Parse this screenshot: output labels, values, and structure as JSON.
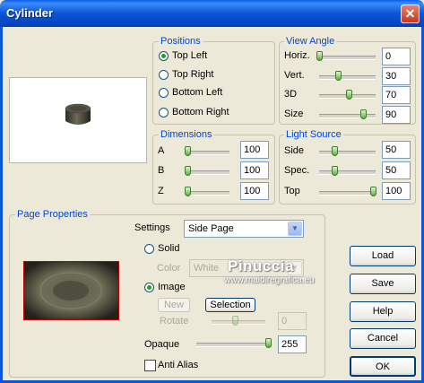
{
  "window": {
    "title": "Cylinder",
    "close_glyph": "✕"
  },
  "positions": {
    "legend": "Positions",
    "options": [
      "Top Left",
      "Top Right",
      "Bottom Left",
      "Bottom Right"
    ],
    "selected": "Top Left"
  },
  "view_angle": {
    "legend": "View Angle",
    "sliders": [
      {
        "label": "Horiz.",
        "value": "0"
      },
      {
        "label": "Vert.",
        "value": "30"
      },
      {
        "label": "3D",
        "value": "70"
      },
      {
        "label": "Size",
        "value": "90"
      }
    ]
  },
  "dimensions": {
    "legend": "Dimensions",
    "sliders": [
      {
        "label": "A",
        "value": "100"
      },
      {
        "label": "B",
        "value": "100"
      },
      {
        "label": "Z",
        "value": "100"
      }
    ]
  },
  "light_source": {
    "legend": "Light Source",
    "sliders": [
      {
        "label": "Side",
        "value": "50"
      },
      {
        "label": "Spec.",
        "value": "50"
      },
      {
        "label": "Top",
        "value": "100"
      }
    ]
  },
  "page_properties": {
    "legend": "Page Properties",
    "settings_label": "Settings",
    "settings_value": "Side Page",
    "solid_label": "Solid",
    "color_label": "Color",
    "color_value": "White",
    "image_label": "Image",
    "new_label": "New",
    "selection_label": "Selection",
    "rotate_label": "Rotate",
    "rotate_value": "0",
    "opaque_label": "Opaque",
    "opaque_value": "255",
    "antialias_label": "Anti Alias",
    "selected_fill": "Image"
  },
  "buttons": {
    "load": "Load",
    "save": "Save",
    "help": "Help",
    "cancel": "Cancel",
    "ok": "OK"
  },
  "watermark": {
    "name": "Pinuccia",
    "site": "www.maidiregrafica.eu"
  },
  "colors": {
    "title_bar": "#0b55d8",
    "legend_text": "#0046d5",
    "dialog_bg": "#ece9d8",
    "texture_border": "#c00000"
  }
}
